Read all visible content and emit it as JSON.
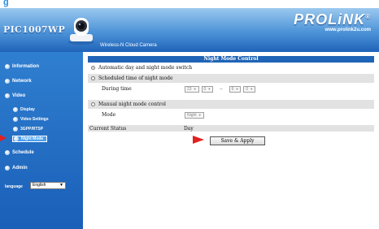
{
  "top_title": "g",
  "header": {
    "model": "PIC1007WP",
    "tagline": "Wireless-N  Cloud Camera",
    "brand": "PROLiNK",
    "brand_mark": "®",
    "website": "www.prolink2u.com"
  },
  "sidebar": {
    "items": [
      {
        "label": "Information"
      },
      {
        "label": "Network"
      },
      {
        "label": "Video"
      },
      {
        "label": "Display"
      },
      {
        "label": "Video Settings"
      },
      {
        "label": "3GPP/RTSP"
      },
      {
        "label": "Night Mode"
      },
      {
        "label": "Schedule"
      },
      {
        "label": "Admin"
      }
    ],
    "language_label": "language",
    "language_value": "English"
  },
  "panel": {
    "title": "Night Mode Control",
    "option_auto": "Automatic day and night mode switch",
    "option_scheduled": "Scheduled time of night mode",
    "during_label": "During time",
    "time_start_hour": "23",
    "time_start_min": "0",
    "time_sep": "--",
    "time_end_hour": "6",
    "time_end_min": "0",
    "option_manual": "Manual night mode control",
    "mode_label": "Mode",
    "mode_value": "Night",
    "status_label": "Current Status",
    "status_value": "Day",
    "save_label": "Save & Apply"
  }
}
